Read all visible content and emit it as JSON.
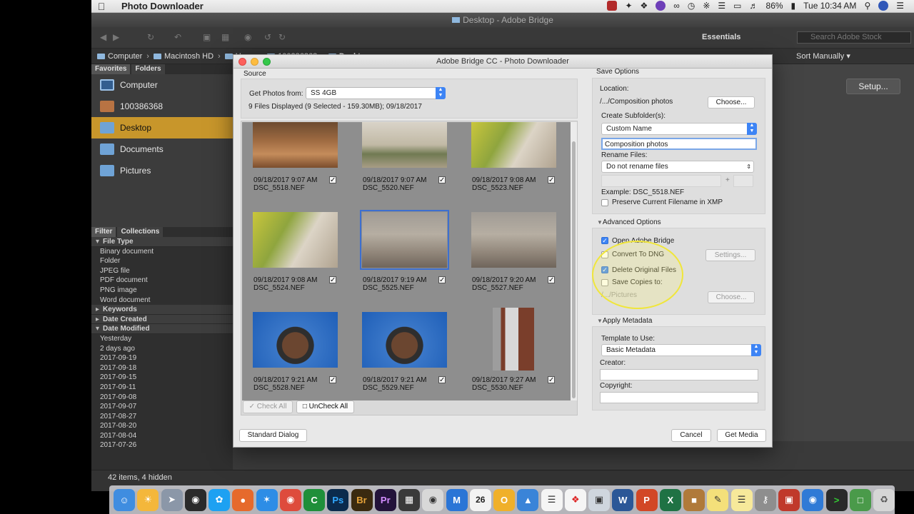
{
  "menubar": {
    "app_name": "Photo Downloader",
    "battery": "86%",
    "clock": "Tue 10:34 AM"
  },
  "bridge": {
    "window_title": "Desktop - Adobe Bridge",
    "workspace": "Essentials",
    "stock_search_placeholder": "Search Adobe Stock",
    "sort_label": "Sort Manually",
    "breadcrumb": [
      "Computer",
      "Macintosh HD",
      "Users",
      "100386368",
      "Desktop"
    ],
    "fav_tabs": [
      "Favorites",
      "Folders"
    ],
    "favorites": [
      "Computer",
      "100386368",
      "Desktop",
      "Documents",
      "Pictures"
    ],
    "filter_tabs": [
      "Filter",
      "Collections"
    ],
    "filter": {
      "file_type_head": "File Type",
      "file_types": [
        "Binary document",
        "Folder",
        "JPEG file",
        "PDF document",
        "PNG image",
        "Word document"
      ],
      "keywords_head": "Keywords",
      "date_created_head": "Date Created",
      "date_modified_head": "Date Modified",
      "dates": [
        "Yesterday",
        "2 days ago",
        "2017-09-19",
        "2017-09-18",
        "2017-09-15",
        "2017-09-11",
        "2017-09-08",
        "2017-09-07",
        "2017-08-27",
        "2017-08-20",
        "2017-08-04",
        "2017-07-26"
      ]
    },
    "setup_button": "Setup...",
    "items_count": "42 items, 4 hidden"
  },
  "dialog": {
    "title": "Adobe Bridge CC - Photo Downloader",
    "source_label": "Source",
    "get_photos_label": "Get Photos from:",
    "device": "SS 4GB",
    "files_info": "9 Files Displayed (9 Selected - 159.30MB); 09/18/2017",
    "thumbnails": [
      {
        "date": "09/18/2017 9:07 AM",
        "name": "DSC_5518.NEF"
      },
      {
        "date": "09/18/2017 9:07 AM",
        "name": "DSC_5520.NEF"
      },
      {
        "date": "09/18/2017 9:08 AM",
        "name": "DSC_5523.NEF"
      },
      {
        "date": "09/18/2017 9:08 AM",
        "name": "DSC_5524.NEF"
      },
      {
        "date": "09/18/2017 9:19 AM",
        "name": "DSC_5525.NEF"
      },
      {
        "date": "09/18/2017 9:20 AM",
        "name": "DSC_5527.NEF"
      },
      {
        "date": "09/18/2017 9:21 AM",
        "name": "DSC_5528.NEF"
      },
      {
        "date": "09/18/2017 9:21 AM",
        "name": "DSC_5529.NEF"
      },
      {
        "date": "09/18/2017 9:27 AM",
        "name": "DSC_5530.NEF"
      }
    ],
    "check_all": "Check All",
    "uncheck_all": "UnCheck All",
    "standard_dialog": "Standard Dialog",
    "cancel": "Cancel",
    "get_media": "Get Media",
    "save_options": {
      "title": "Save Options",
      "location_label": "Location:",
      "location_value": "/.../Composition photos",
      "choose": "Choose...",
      "subfolder_label": "Create Subfolder(s):",
      "subfolder_value": "Custom Name",
      "subfolder_name": "Composition photos",
      "rename_label": "Rename Files:",
      "rename_value": "Do not rename files",
      "plus": "+",
      "example": "Example:  DSC_5518.NEF",
      "preserve": "Preserve Current Filename in XMP"
    },
    "advanced": {
      "title": "Advanced Options",
      "open_bridge": "Open Adobe Bridge",
      "convert_dng": "Convert To DNG",
      "settings": "Settings...",
      "delete_originals": "Delete Original Files",
      "save_copies": "Save Copies to:",
      "copies_path": "/.../Pictures",
      "choose": "Choose..."
    },
    "metadata": {
      "title": "Apply Metadata",
      "template_label": "Template to Use:",
      "template_value": "Basic Metadata",
      "creator_label": "Creator:",
      "copyright_label": "Copyright:"
    }
  },
  "dock": {
    "calendar_day": "26"
  }
}
